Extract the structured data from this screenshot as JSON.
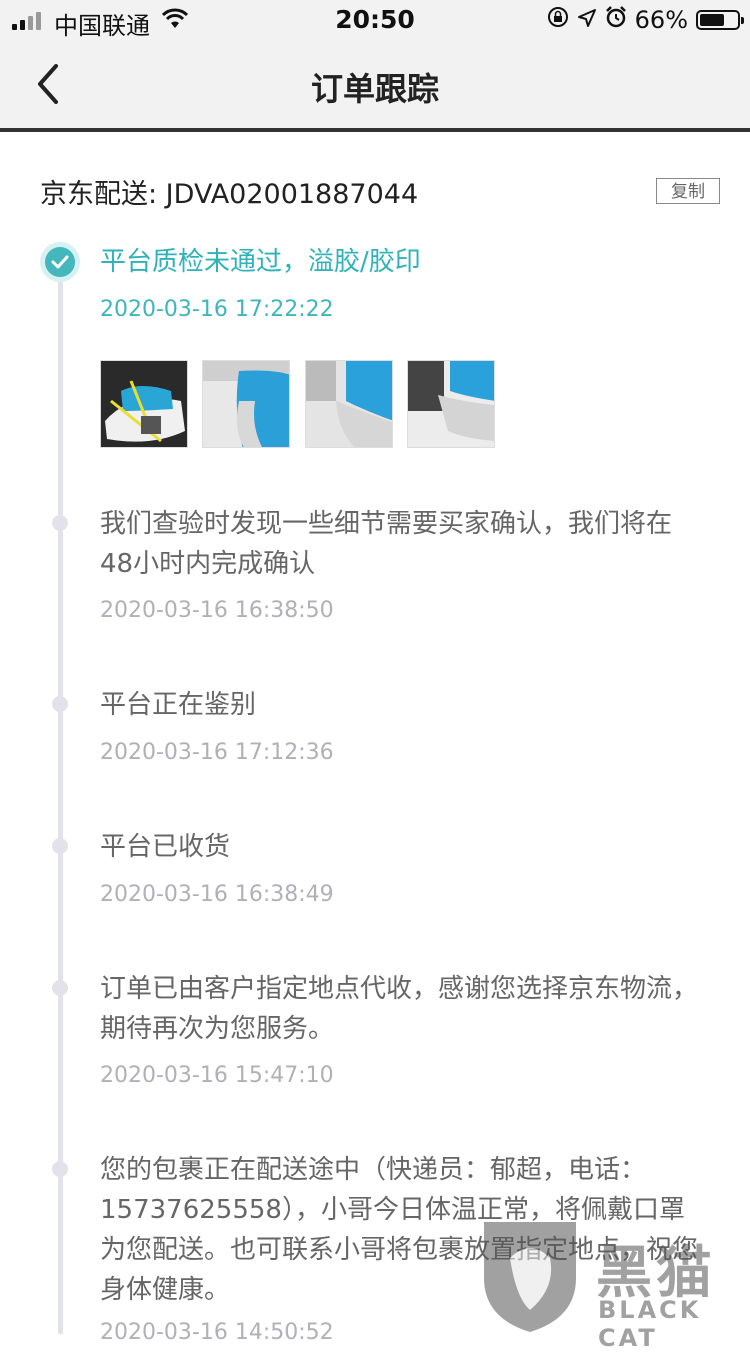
{
  "status_bar": {
    "carrier": "中国联通",
    "time": "20:50",
    "battery": "66%",
    "battery_level": 0.66
  },
  "nav": {
    "title": "订单跟踪"
  },
  "shipment": {
    "carrier_label": "京东配送: JDVA02001887044",
    "copy_label": "复制"
  },
  "events": [
    {
      "title": "平台质检未通过，溢胶/胶印",
      "time": "2020-03-16 17:22:22"
    },
    {
      "title": "我们查验时发现一些细节需要买家确认，我们将在48小时内完成确认",
      "time": "2020-03-16 16:38:50"
    },
    {
      "title": "平台正在鉴别",
      "time": "2020-03-16 17:12:36"
    },
    {
      "title": "平台已收货",
      "time": "2020-03-16 16:38:49"
    },
    {
      "title": "订单已由客户指定地点代收，感谢您选择京东物流，期待再次为您服务。",
      "time": "2020-03-16 15:47:10"
    },
    {
      "title": "您的包裹正在配送途中（快递员：郁超，电话：15737625558），小哥今日体温正常，将佩戴口罩为您配送。也可联系小哥将包裹放置指定地点，祝您身体健康。",
      "time": "2020-03-16 14:50:52"
    }
  ],
  "watermark": {
    "logo_text": "黑猫",
    "sub_text": "BLACK CAT"
  },
  "colors": {
    "accent": "#2fb3b9",
    "timeline": "#e2e2ea",
    "nav_bg": "#f2f2f2"
  }
}
